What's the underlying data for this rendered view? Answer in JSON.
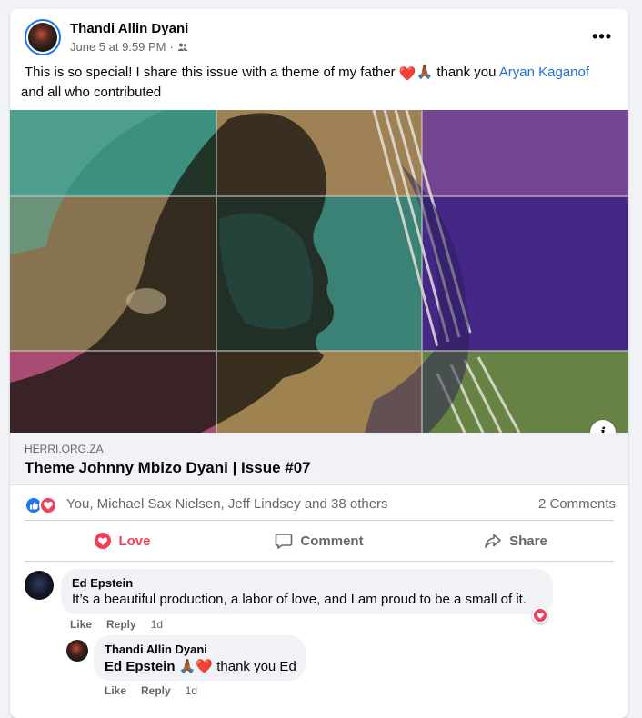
{
  "post": {
    "author": "Thandi Allin Dyani",
    "timestamp": "June 5 at 9:59 PM",
    "audience_icon": "friends-icon",
    "text_part1": "This is so special! I share this issue with a theme of my father ",
    "text_part2": " thank you ",
    "mention": "Aryan Kaganof",
    "text_part3": " and all who contributed",
    "emoji_heart": "❤️",
    "emoji_pray": "🙏🏾"
  },
  "link_preview": {
    "domain": "HERRI.ORG.ZA",
    "title": "Theme Johnny Mbizo Dyani | Issue #07"
  },
  "reactions": {
    "names": "You, Michael Sax Nielsen, Jeff Lindsey and 38 others",
    "comments_count": "2 Comments"
  },
  "actions": {
    "love": "Love",
    "comment": "Comment",
    "share": "Share"
  },
  "comments": [
    {
      "author": "Ed Epstein",
      "text": "It’s a beautiful production, a labor of love, and I am proud to be a small of it.",
      "like": "Like",
      "reply": "Reply",
      "age": "1d"
    },
    {
      "author": "Thandi Allin Dyani",
      "mention": "Ed Epstein",
      "emojis": "🙏🏾❤️",
      "text": "thank you Ed",
      "like": "Like",
      "reply": "Reply",
      "age": "1d"
    }
  ],
  "colors": {
    "accent_blue": "#1877f2",
    "love_red": "#f33e58",
    "link_blue": "#216fdb"
  }
}
